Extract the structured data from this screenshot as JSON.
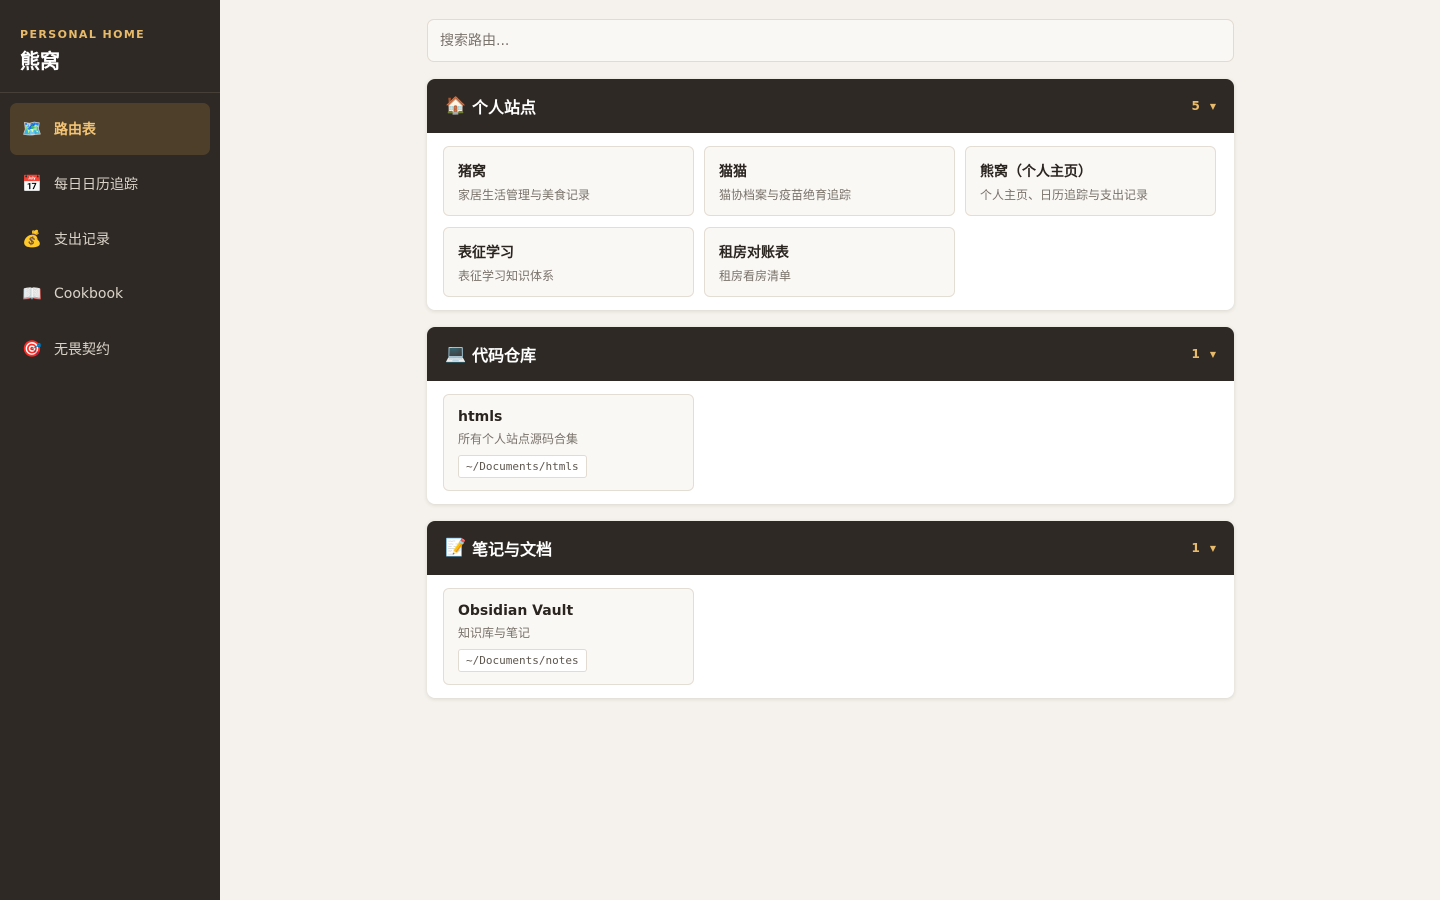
{
  "brand": {
    "subtitle": "PERSONAL HOME",
    "title": "熊窝"
  },
  "nav": [
    {
      "icon": "🗺️",
      "icon_name": "map-icon",
      "label": "路由表",
      "active": true
    },
    {
      "icon": "📅",
      "icon_name": "calendar-icon",
      "label": "每日日历追踪",
      "active": false
    },
    {
      "icon": "💰",
      "icon_name": "money-bag-icon",
      "label": "支出记录",
      "active": false
    },
    {
      "icon": "📖",
      "icon_name": "book-icon",
      "label": "Cookbook",
      "active": false
    },
    {
      "icon": "🎯",
      "icon_name": "target-icon",
      "label": "无畏契约",
      "active": false
    }
  ],
  "search": {
    "placeholder": "搜索路由...",
    "value": ""
  },
  "groups": [
    {
      "emoji": "🏠",
      "icon_name": "house-icon",
      "title": "个人站点",
      "count": "5",
      "chevron": "▼",
      "cards": [
        {
          "title": "猪窝",
          "desc": "家居生活管理与美食记录"
        },
        {
          "title": "猫猫",
          "desc": "猫协档案与疫苗绝育追踪"
        },
        {
          "title": "熊窝（个人主页）",
          "desc": "个人主页、日历追踪与支出记录"
        },
        {
          "title": "表征学习",
          "desc": "表征学习知识体系"
        },
        {
          "title": "租房对账表",
          "desc": "租房看房清单"
        }
      ]
    },
    {
      "emoji": "💻",
      "icon_name": "laptop-icon",
      "title": "代码仓库",
      "count": "1",
      "chevron": "▼",
      "cards": [
        {
          "title": "htmls",
          "desc": "所有个人站点源码合集",
          "path": "~/Documents/htmls"
        }
      ]
    },
    {
      "emoji": "📝",
      "icon_name": "memo-icon",
      "title": "笔记与文档",
      "count": "1",
      "chevron": "▼",
      "cards": [
        {
          "title": "Obsidian Vault",
          "desc": "知识库与笔记",
          "path": "~/Documents/notes"
        }
      ]
    }
  ],
  "colors": {
    "sidebar_bg": "#2e2924",
    "accent": "#e8bb6a",
    "active_bg": "#4e3f2b",
    "page_bg": "#f5f2ed"
  }
}
